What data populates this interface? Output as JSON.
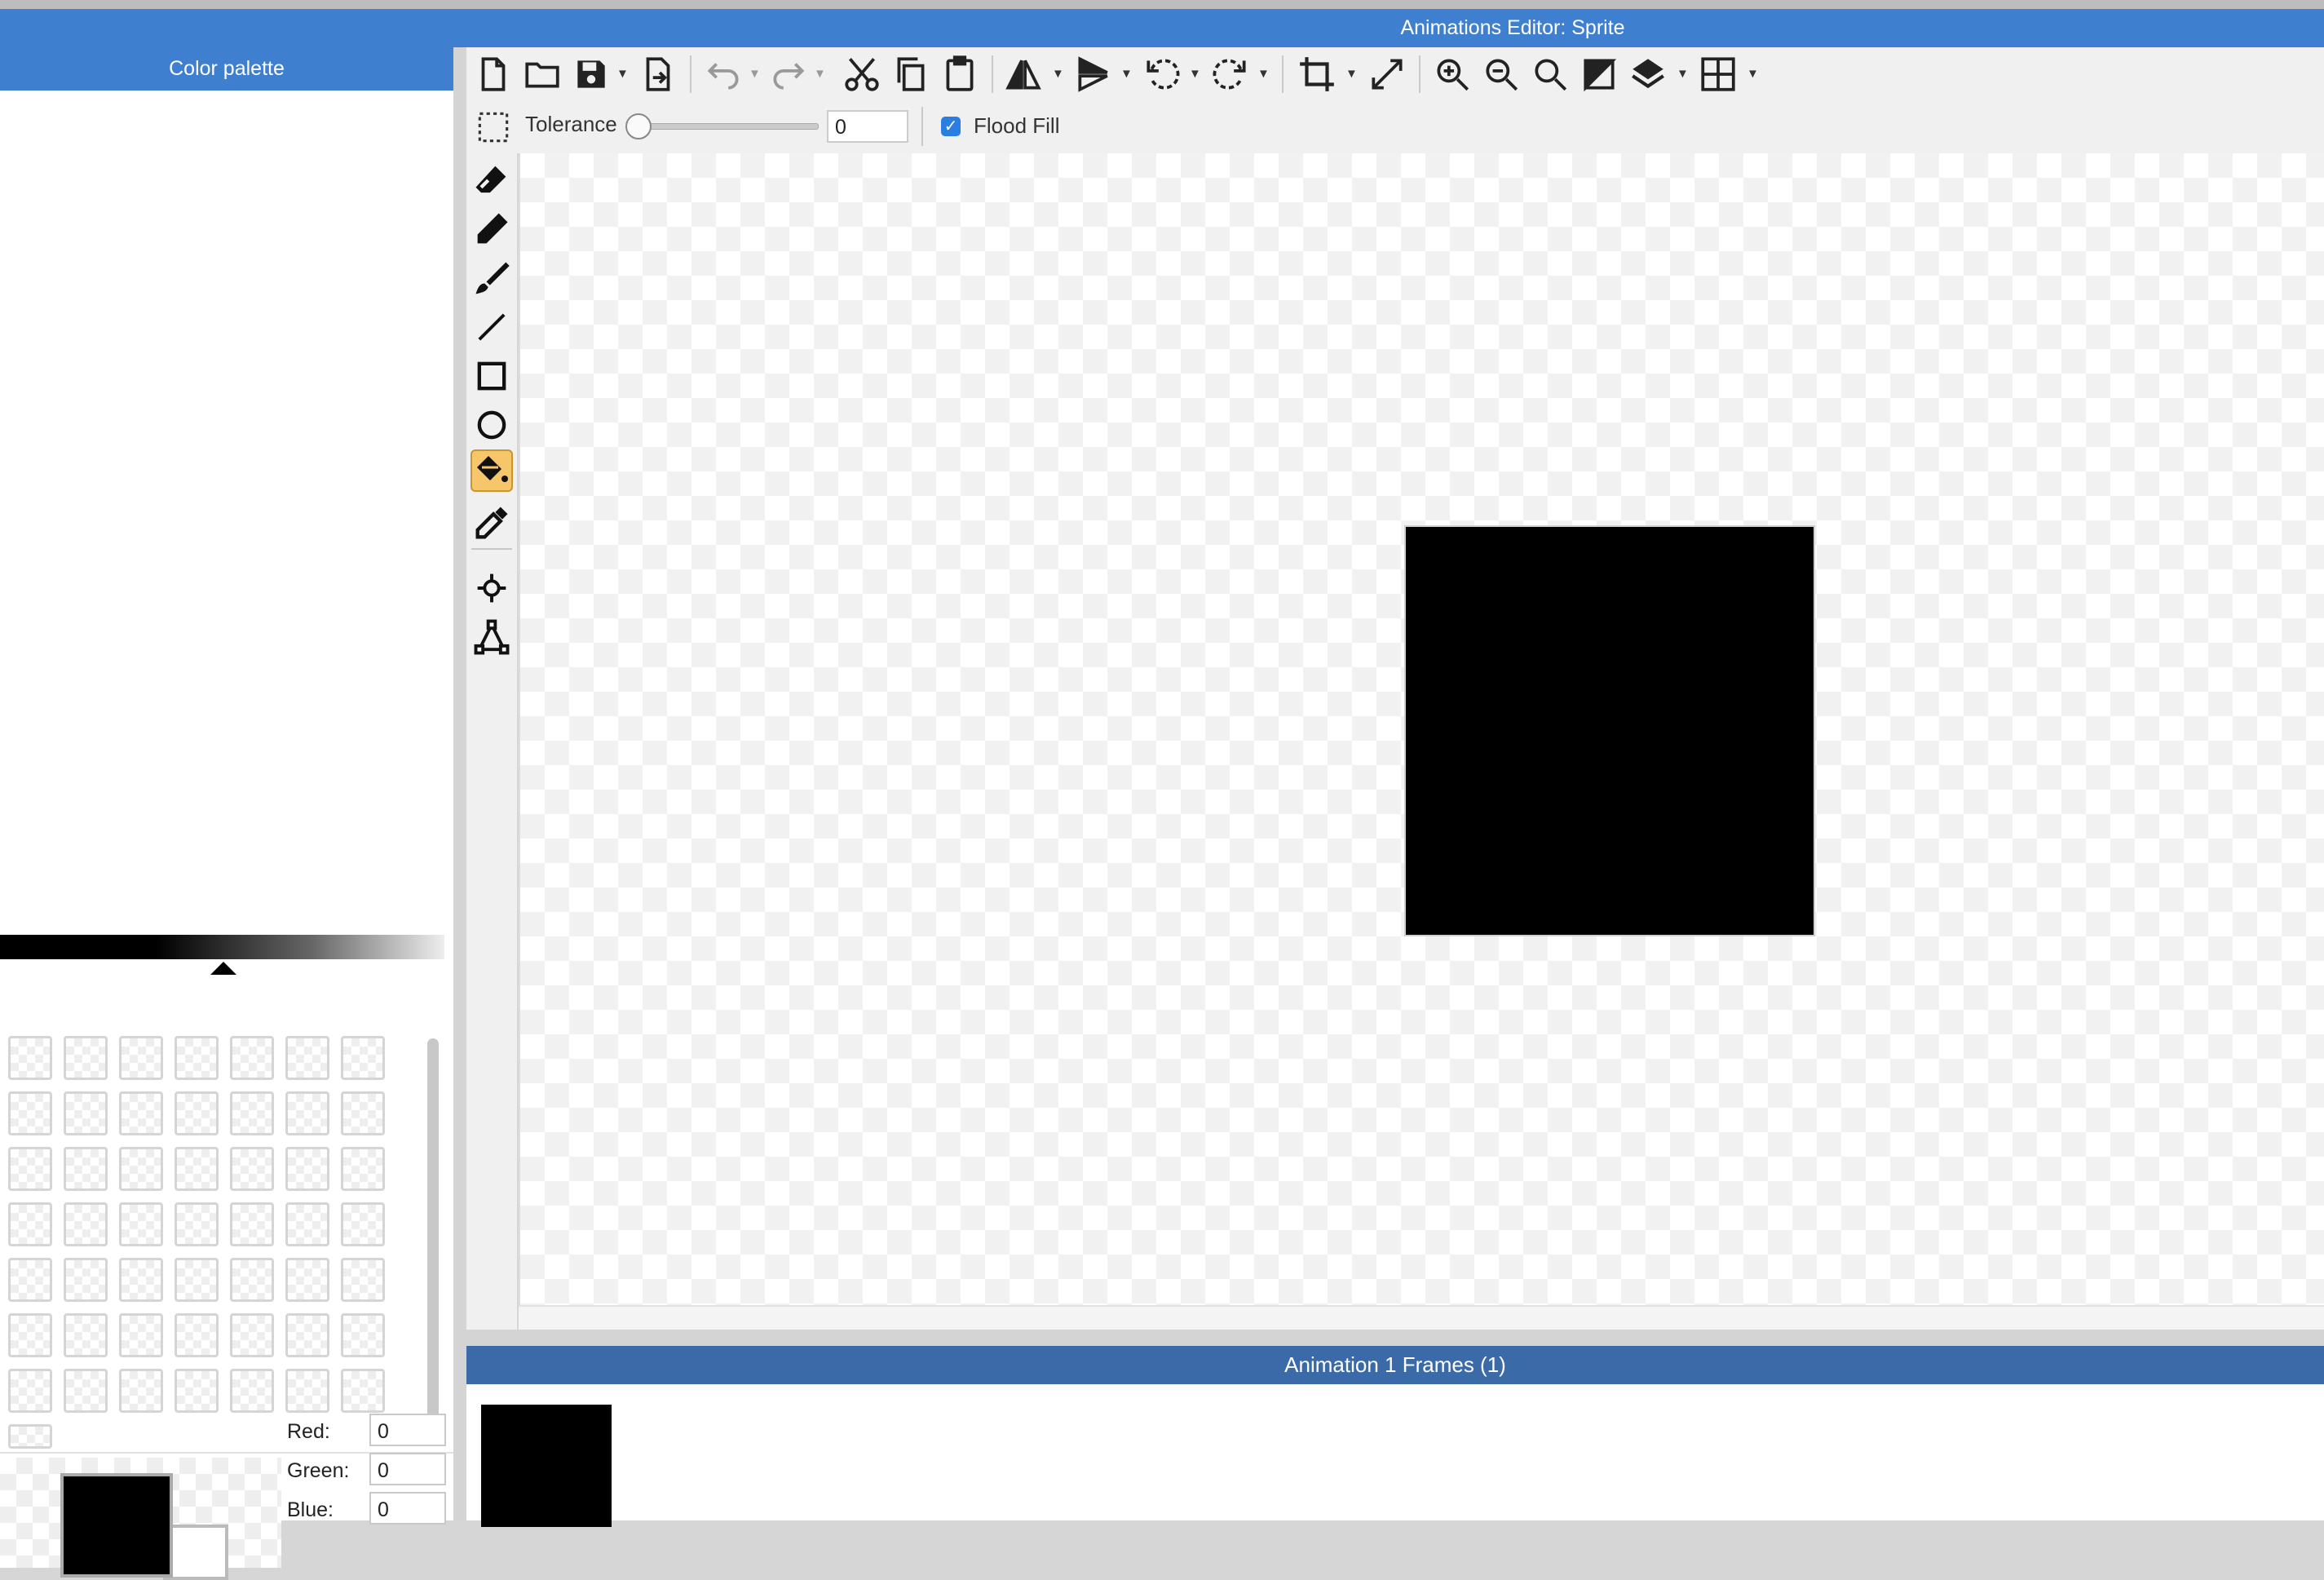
{
  "window": {
    "title": "Animations Editor: Sprite"
  },
  "color_palette": {
    "title": "Color palette",
    "rgb": {
      "red_label": "Red:",
      "red_value": "0",
      "green_label": "Green:",
      "green_value": "0",
      "blue_label": "Blue:",
      "blue_value": "0"
    },
    "primary_color": "#000000",
    "secondary_color": "#ffffff"
  },
  "toolbar": {
    "icons": [
      "new-file-icon",
      "open-folder-icon",
      "save-icon",
      "export-icon",
      "undo-icon",
      "redo-icon",
      "cut-icon",
      "copy-icon",
      "paste-icon",
      "flip-horizontal-icon",
      "flip-vertical-icon",
      "rotate-left-icon",
      "rotate-right-icon",
      "crop-icon",
      "resize-icon",
      "zoom-in-icon",
      "zoom-out-icon",
      "zoom-fit-icon",
      "invert-icon",
      "layers-icon",
      "grid-icon"
    ]
  },
  "options": {
    "tolerance_label": "Tolerance",
    "tolerance_value": "0",
    "flood_fill_label": "Flood Fill",
    "flood_fill_checked": true
  },
  "tools": {
    "items": [
      "eraser-icon",
      "pencil-icon",
      "brush-icon",
      "line-icon",
      "rectangle-icon",
      "ellipse-icon",
      "paint-bucket-icon",
      "eyedropper-icon",
      "pivot-icon",
      "anchor-points-icon"
    ],
    "active": "paint-bucket-icon"
  },
  "frames": {
    "title": "Animation 1 Frames (1)"
  },
  "colors": {
    "accent": "#3f7fcf",
    "frames_header": "#3a6aa8",
    "active_tool": "#f6c66a",
    "checkbox": "#2a7de1"
  }
}
